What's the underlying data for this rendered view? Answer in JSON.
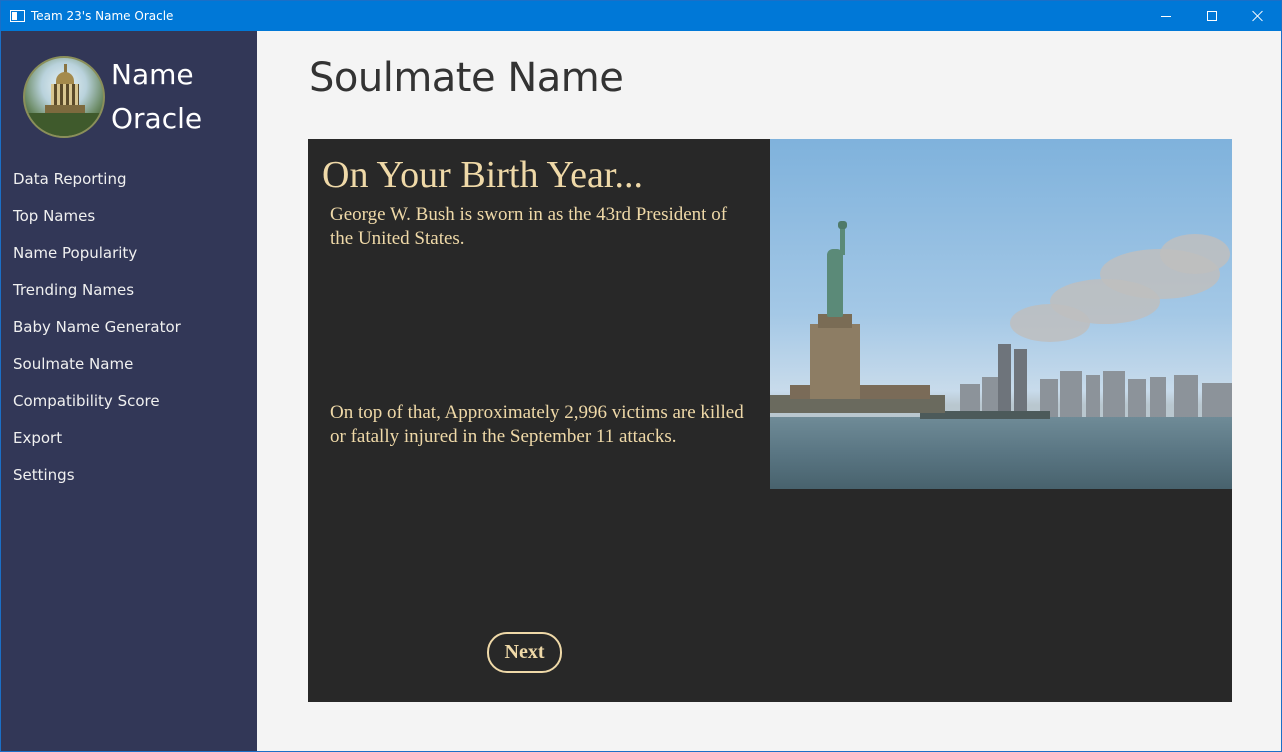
{
  "window": {
    "title": "Team 23's Name Oracle"
  },
  "sidebar": {
    "app_name_line1": "Name",
    "app_name_line2": "Oracle",
    "items": [
      {
        "label": "Data Reporting"
      },
      {
        "label": "Top Names"
      },
      {
        "label": "Name Popularity"
      },
      {
        "label": "Trending Names"
      },
      {
        "label": "Baby Name Generator"
      },
      {
        "label": "Soulmate Name"
      },
      {
        "label": "Compatibility Score"
      },
      {
        "label": "Export"
      },
      {
        "label": "Settings"
      }
    ]
  },
  "main": {
    "page_title": "Soulmate Name",
    "card": {
      "heading": "On Your Birth Year...",
      "fact1": "George W. Bush is sworn in as the 43rd President of the United States.",
      "fact2": "On top of that,  Approximately 2,996 victims are killed or fatally injured in the September 11 attacks.",
      "next_label": "Next"
    }
  },
  "colors": {
    "titlebar": "#0078d7",
    "sidebar_bg": "#323757",
    "card_bg": "#282828",
    "card_text": "#efd9a8"
  }
}
